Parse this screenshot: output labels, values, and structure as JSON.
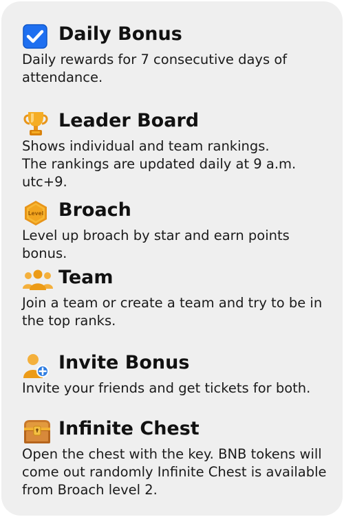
{
  "features": [
    {
      "icon": "checkbox-icon",
      "title": "Daily Bonus",
      "description": "Daily rewards for 7 consecutive days of\nattendance."
    },
    {
      "icon": "trophy-icon",
      "title": "Leader Board",
      "description": "Shows individual and team rankings.\nThe rankings are updated daily at 9 a.m. utc+9."
    },
    {
      "icon": "level-badge-icon",
      "icon_text": "Level",
      "title": "Broach",
      "description": "Level up broach by star and earn points bonus."
    },
    {
      "icon": "team-icon",
      "title": "Team",
      "description": "Join a team or create a team and try to be in\nthe top ranks."
    },
    {
      "icon": "invite-user-icon",
      "title": "Invite Bonus",
      "description": "Invite your friends and get tickets for both."
    },
    {
      "icon": "treasure-chest-icon",
      "title": "Infinite Chest",
      "description": "Open the chest with the key. BNB tokens will\ncome out randomly Infinite Chest is available\nfrom Broach level 2."
    }
  ],
  "colors": {
    "card_background": "#efefef",
    "checkbox_blue": "#1e6ff0",
    "gold": "#f2a51f",
    "gold_dark": "#d9820c",
    "chest_brown": "#b5651d"
  }
}
